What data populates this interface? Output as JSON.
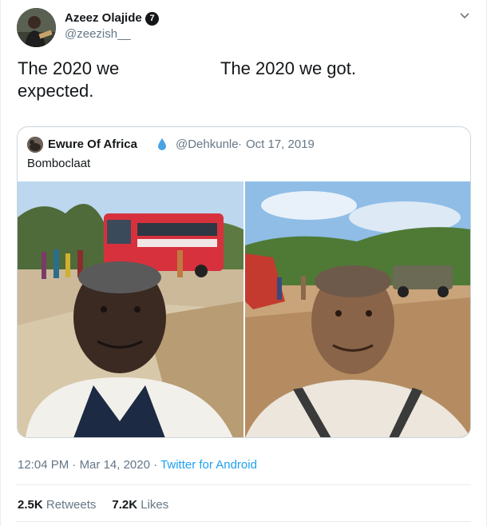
{
  "author": {
    "display_name": "Azeez Olajide",
    "verified_mark": "7",
    "handle": "@zeezish__"
  },
  "tweet": {
    "text_left": "The 2020 we expected.",
    "text_right": "The 2020 we got."
  },
  "quoted": {
    "display_name": "Ewure Of Africa",
    "emoji": "droplet-icon",
    "handle": "@Dehkunle",
    "separator": "·",
    "date": "Oct 17, 2019",
    "text": "Bomboclaat",
    "photos": [
      {
        "name": "bus-selfie-photo"
      },
      {
        "name": "crash-selfie-photo"
      }
    ]
  },
  "meta": {
    "time": "12:04 PM",
    "sep1": "·",
    "date": "Mar 14, 2020",
    "sep2": "·",
    "source": "Twitter for Android"
  },
  "stats": {
    "retweets_count": "2.5K",
    "retweets_label": "Retweets",
    "likes_count": "7.2K",
    "likes_label": "Likes"
  },
  "colors": {
    "link": "#1da1f2",
    "secondary": "#657786",
    "border": "#ccd6dd"
  }
}
